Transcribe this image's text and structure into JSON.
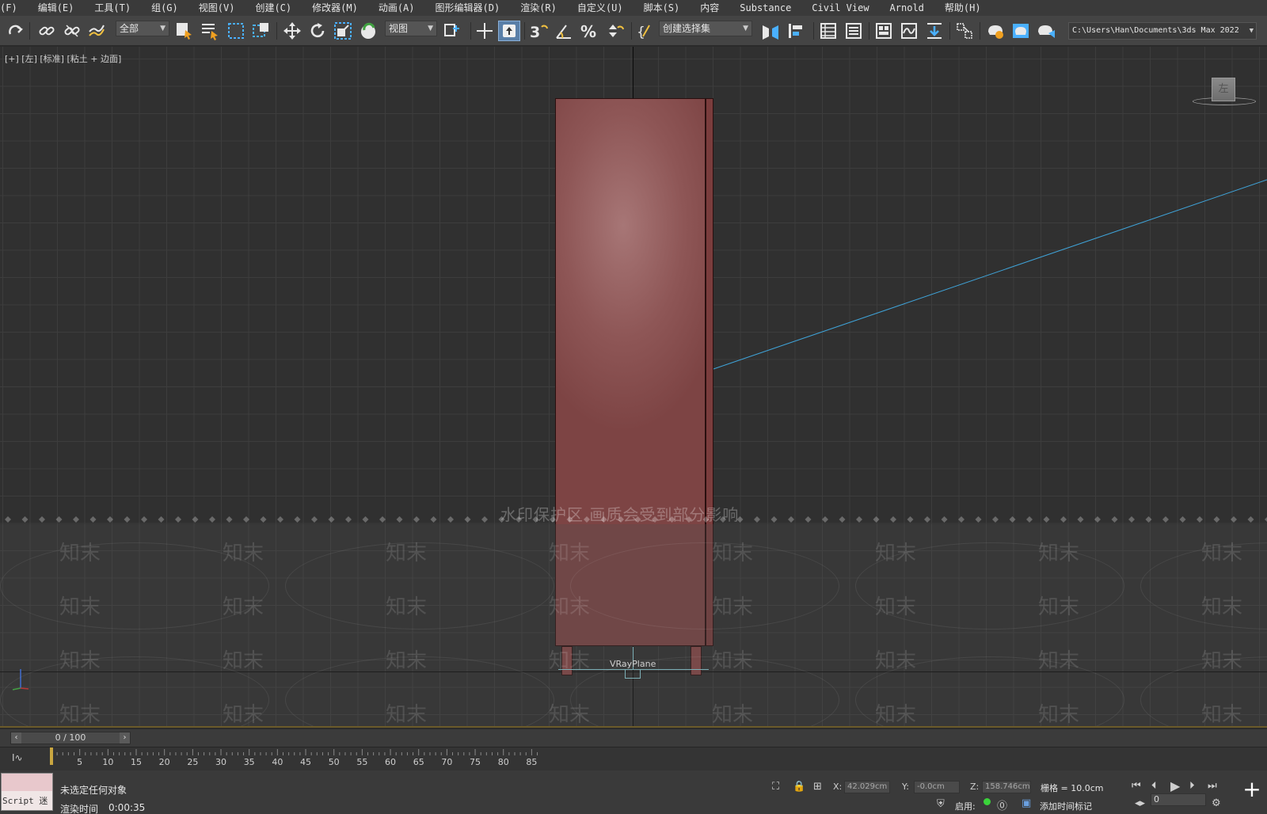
{
  "menu": [
    {
      "label": "(F)"
    },
    {
      "label": "编辑(E)"
    },
    {
      "label": "工具(T)"
    },
    {
      "label": "组(G)"
    },
    {
      "label": "视图(V)"
    },
    {
      "label": "创建(C)"
    },
    {
      "label": "修改器(M)"
    },
    {
      "label": "动画(A)"
    },
    {
      "label": "图形编辑器(D)"
    },
    {
      "label": "渲染(R)"
    },
    {
      "label": "自定义(U)"
    },
    {
      "label": "脚本(S)"
    },
    {
      "label": "内容"
    },
    {
      "label": "Substance"
    },
    {
      "label": "Civil View"
    },
    {
      "label": "Arnold"
    },
    {
      "label": "帮助(H)"
    }
  ],
  "toolbar": {
    "selection_filter": "全部",
    "reference_coord": "视图",
    "named_selection": "创建选择集",
    "project_path": "C:\\Users\\Han\\Documents\\3ds Max 2022"
  },
  "viewport": {
    "label": "[+] [左] [标准] [粘土 + 边面]",
    "object_label": "VRayPlane",
    "viewcube_face": "左"
  },
  "watermark": {
    "notice": "水印保护区  画质会受到部分影响",
    "brand": "知末"
  },
  "timeline": {
    "slider_text": "0 / 100",
    "ticks": [
      "5",
      "10",
      "15",
      "20",
      "25",
      "30",
      "35",
      "40",
      "45",
      "50",
      "55",
      "60",
      "65",
      "70",
      "75",
      "80",
      "85"
    ]
  },
  "status": {
    "script_label": "Script 迷",
    "selection_status": "未选定任何对象",
    "render_time_label": "渲染时间",
    "render_time_value": "0:00:35",
    "x_label": "X:",
    "x_value": "42.029cm",
    "y_label": "Y:",
    "y_value": "-0.0cm",
    "z_label": "Z:",
    "z_value": "158.746cm",
    "grid_text": "栅格 = 10.0cm",
    "enabled_label": "启用:",
    "add_time_tag": "添加时间标记",
    "frame_value": "0"
  },
  "colors": {
    "cabinet": "#8e5656",
    "camera_line": "#3fa3d8",
    "plane_outline": "#8fd6e0",
    "timeline_accent": "#6b5a2a"
  }
}
